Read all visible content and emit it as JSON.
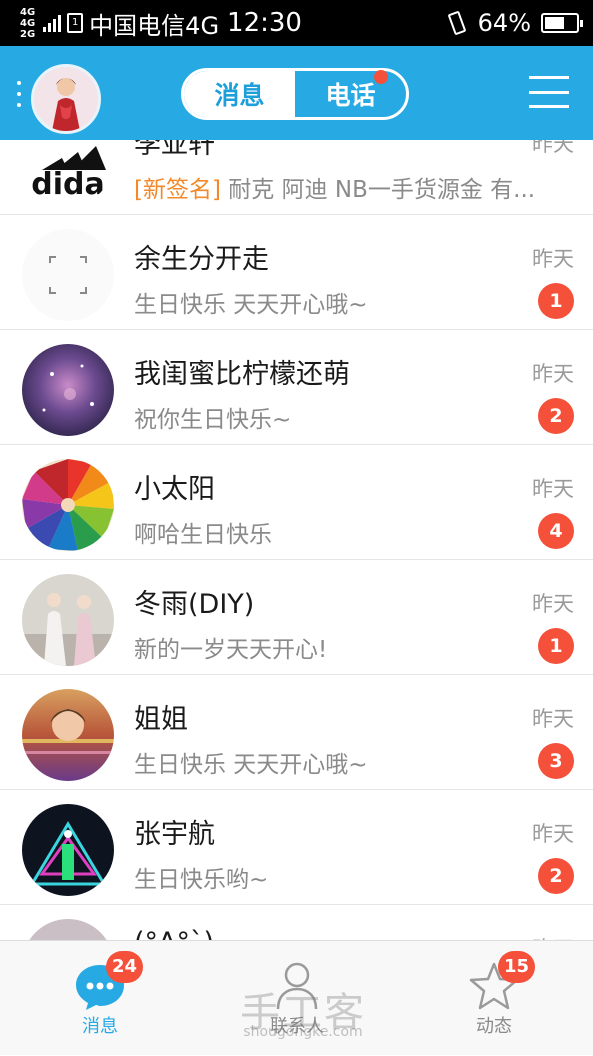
{
  "status_bar": {
    "net_top": "4G",
    "net_mid": "4G",
    "net_bottom": "2G",
    "carrier": "中国电信4G",
    "time": "12:30",
    "battery": "64%",
    "battery_level": 0.64
  },
  "header": {
    "tabs": [
      {
        "label": "消息",
        "active": true
      },
      {
        "label": "电话",
        "active": false,
        "has_dot": true
      }
    ],
    "menu_icon": "hamburger-icon",
    "avatar_icon": "profile-avatar"
  },
  "conversations": [
    {
      "name": "李亚轩",
      "tag": "[新签名]",
      "preview": "耐克 阿迪 NB一手货源金 有...",
      "time": "昨天",
      "badge": ""
    },
    {
      "name": "余生分开走",
      "preview": "生日快乐 天天开心哦~",
      "time": "昨天",
      "badge": "1"
    },
    {
      "name": "我闺蜜比柠檬还萌",
      "preview": "祝你生日快乐~",
      "time": "昨天",
      "badge": "2"
    },
    {
      "name": "小太阳",
      "preview": "啊哈生日快乐",
      "time": "昨天",
      "badge": "4"
    },
    {
      "name": "冬雨(DIY)",
      "preview": "新的一岁天天开心!",
      "time": "昨天",
      "badge": "1"
    },
    {
      "name": "姐姐",
      "preview": "生日快乐 天天开心哦~",
      "time": "昨天",
      "badge": "3"
    },
    {
      "name": "张宇航",
      "preview": "生日快乐哟~",
      "time": "昨天",
      "badge": "2"
    },
    {
      "name": "(°A°`)",
      "preview": "",
      "time": "昨天",
      "badge": ""
    }
  ],
  "bottom_nav": [
    {
      "label": "消息",
      "badge": "24",
      "icon": "chat-bubble-icon",
      "active": true
    },
    {
      "label": "联系人",
      "badge": "",
      "icon": "person-icon",
      "active": false
    },
    {
      "label": "动态",
      "badge": "15",
      "icon": "star-icon",
      "active": false
    }
  ],
  "watermark": {
    "title": "手工客",
    "url": "shougongke.com"
  },
  "colors": {
    "accent": "#27a9e3",
    "badge": "#f5503a",
    "tag": "#f28a2c"
  }
}
